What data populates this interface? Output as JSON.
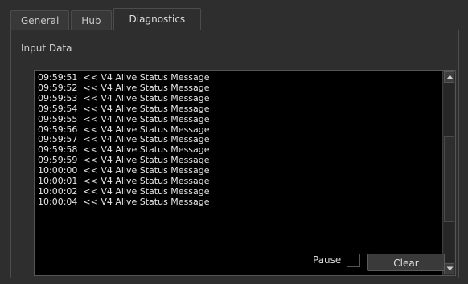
{
  "tabs": [
    {
      "label": "General"
    },
    {
      "label": "Hub"
    },
    {
      "label": "Diagnostics"
    }
  ],
  "active_tab": "Diagnostics",
  "group_title": "Input Data",
  "log_lines": [
    "09:59:51  << V4 Alive Status Message",
    "09:59:52  << V4 Alive Status Message",
    "09:59:53  << V4 Alive Status Message",
    "09:59:54  << V4 Alive Status Message",
    "09:59:55  << V4 Alive Status Message",
    "09:59:56  << V4 Alive Status Message",
    "09:59:57  << V4 Alive Status Message",
    "09:59:58  << V4 Alive Status Message",
    "09:59:59  << V4 Alive Status Message",
    "10:00:00  << V4 Alive Status Message",
    "10:00:01  << V4 Alive Status Message",
    "10:00:02  << V4 Alive Status Message",
    "10:00:04  << V4 Alive Status Message"
  ],
  "pause_label": "Pause",
  "pause_checked": false,
  "clear_label": "Clear",
  "icons": {
    "scroll_up": "triangle-up-icon",
    "scroll_down": "triangle-down-icon"
  }
}
